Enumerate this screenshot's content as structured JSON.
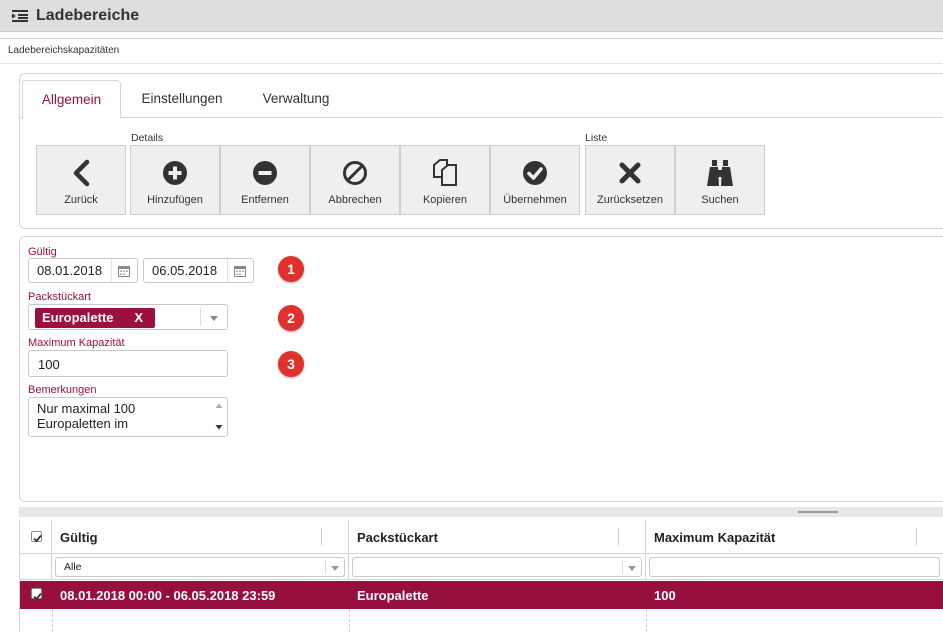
{
  "window": {
    "title": "Ladebereiche",
    "title_icon": "list-indent-icon"
  },
  "subtitle": "Ladebereichskapazitäten",
  "tabs": [
    {
      "label": "Allgemein",
      "active": true
    },
    {
      "label": "Einstellungen",
      "active": false
    },
    {
      "label": "Verwaltung",
      "active": false
    }
  ],
  "toolbar": {
    "group_details": "Details",
    "group_liste": "Liste",
    "buttons": [
      {
        "label": "Zurück",
        "icon": "chevron-left-icon"
      },
      {
        "label": "Hinzufügen",
        "icon": "plus-circle-icon"
      },
      {
        "label": "Entfernen",
        "icon": "minus-circle-icon"
      },
      {
        "label": "Abbrechen",
        "icon": "ban-icon"
      },
      {
        "label": "Kopieren",
        "icon": "copy-icon"
      },
      {
        "label": "Übernehmen",
        "icon": "check-circle-icon"
      },
      {
        "label": "Zurücksetzen",
        "icon": "x-icon"
      },
      {
        "label": "Suchen",
        "icon": "binoculars-icon"
      }
    ]
  },
  "form": {
    "gueltig_label": "Gültig",
    "date_from": "08.01.2018",
    "date_to": "06.05.2018",
    "packstueckart_label": "Packstückart",
    "packstueckart_chip": "Europalette",
    "chip_remove": "X",
    "max_kapazitaet_label": "Maximum Kapazität",
    "max_kapazitaet_value": "100",
    "bemerkungen_label": "Bemerkungen",
    "bemerkungen_line1": "Nur maximal 100",
    "bemerkungen_line2": "Europaletten im"
  },
  "annotations": [
    "1",
    "2",
    "3"
  ],
  "grid": {
    "columns": [
      "Gültig",
      "Packstückart",
      "Maximum Kapazität"
    ],
    "filter_gueltig": "Alle",
    "rows": [
      {
        "selected": true,
        "gueltig": "08.01.2018 00:00 - 06.05.2018 23:59",
        "packstueckart": "Europalette",
        "max_kapazitaet": "100"
      }
    ]
  },
  "colors": {
    "accent": "#9b1040",
    "selected_row": "#970f3f",
    "badge": "#e0312f",
    "button_bg": "#efefef"
  }
}
